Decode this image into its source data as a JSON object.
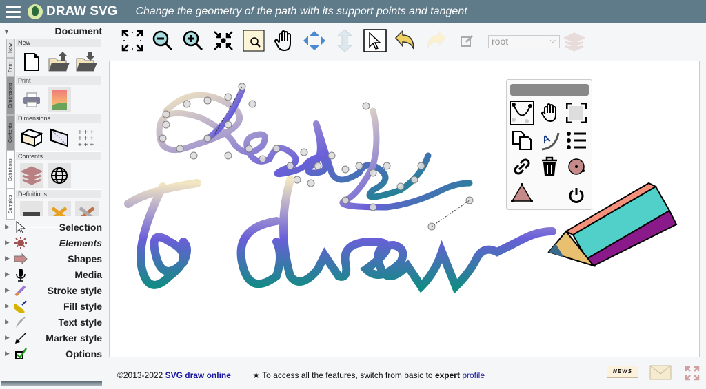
{
  "header": {
    "app_name": "DRAW SVG",
    "subtitle": "Change the geometry of the path with its support points and tangent",
    "icons": [
      "menu-icon",
      "logo-bird-icon"
    ]
  },
  "sidebar": {
    "document_title": "Document",
    "vertical_tabs": [
      "New",
      "Print",
      "Dimensions",
      "Contents",
      "Definitions",
      "Samples"
    ],
    "groups": [
      {
        "title": "New",
        "icons": [
          "new-file-icon",
          "open-folder-upload-icon",
          "save-folder-download-icon"
        ]
      },
      {
        "title": "Print",
        "icons": [
          "printer-icon",
          "export-image-icon"
        ]
      },
      {
        "title": "Dimensions",
        "icons": [
          "box-dimensions-icon",
          "box-diagonal-icon",
          "grid-points-icon"
        ]
      },
      {
        "title": "Contents",
        "icons": [
          "layers-icon",
          "globe-icon"
        ]
      },
      {
        "title": "Definitions",
        "icons": [
          "inbox-icon",
          "rainbow-tools-icon",
          "grey-tools-icon"
        ]
      }
    ],
    "sections": [
      {
        "label": "Selection",
        "icon": "cursor-icon"
      },
      {
        "label": "Elements",
        "icon": "elements-icon"
      },
      {
        "label": "Shapes",
        "icon": "arrow-shape-icon"
      },
      {
        "label": "Media",
        "icon": "microphone-icon"
      },
      {
        "label": "Stroke style",
        "icon": "pencil-icon"
      },
      {
        "label": "Fill style",
        "icon": "paint-roller-icon"
      },
      {
        "label": "Text style",
        "icon": "feather-icon"
      },
      {
        "label": "Marker style",
        "icon": "arrow-marker-icon"
      },
      {
        "label": "Options",
        "icon": "checkbox-icon"
      }
    ]
  },
  "toolbar": {
    "tools": [
      "fit-screen-icon",
      "zoom-out-icon",
      "zoom-in-icon",
      "shrink-icon",
      "zoom-area-icon",
      "pan-hand-icon",
      "move-arrows-icon",
      "vertical-resize-icon",
      "select-pointer-icon",
      "undo-icon",
      "redo-icon"
    ],
    "layer_select": "root",
    "edit_icon": "edit-icon",
    "layers_icon": "layers-icon"
  },
  "floating_panel": {
    "tools": [
      "path-edit-icon",
      "hand-icon",
      "select-bounds-icon",
      "duplicate-icon",
      "text-on-path-icon",
      "list-icon",
      "link-icon",
      "trash-icon",
      "circle-point-icon",
      "triangle-icon",
      "power-icon"
    ]
  },
  "footer": {
    "copyright": "©2013-2022 ",
    "link": "SVG draw online",
    "notice_prefix": "To access all the features, switch from basic to ",
    "notice_bold": "expert",
    "notice_link": "profile",
    "icons": [
      "news-icon",
      "mail-icon",
      "fullscreen-icon"
    ],
    "news_label": "NEWS"
  },
  "colors": {
    "header": "#5f7a88",
    "gradient_top": "#f2e6c2",
    "gradient_mid": "#6a5fd8",
    "gradient_bottom": "#1a8a8a"
  }
}
